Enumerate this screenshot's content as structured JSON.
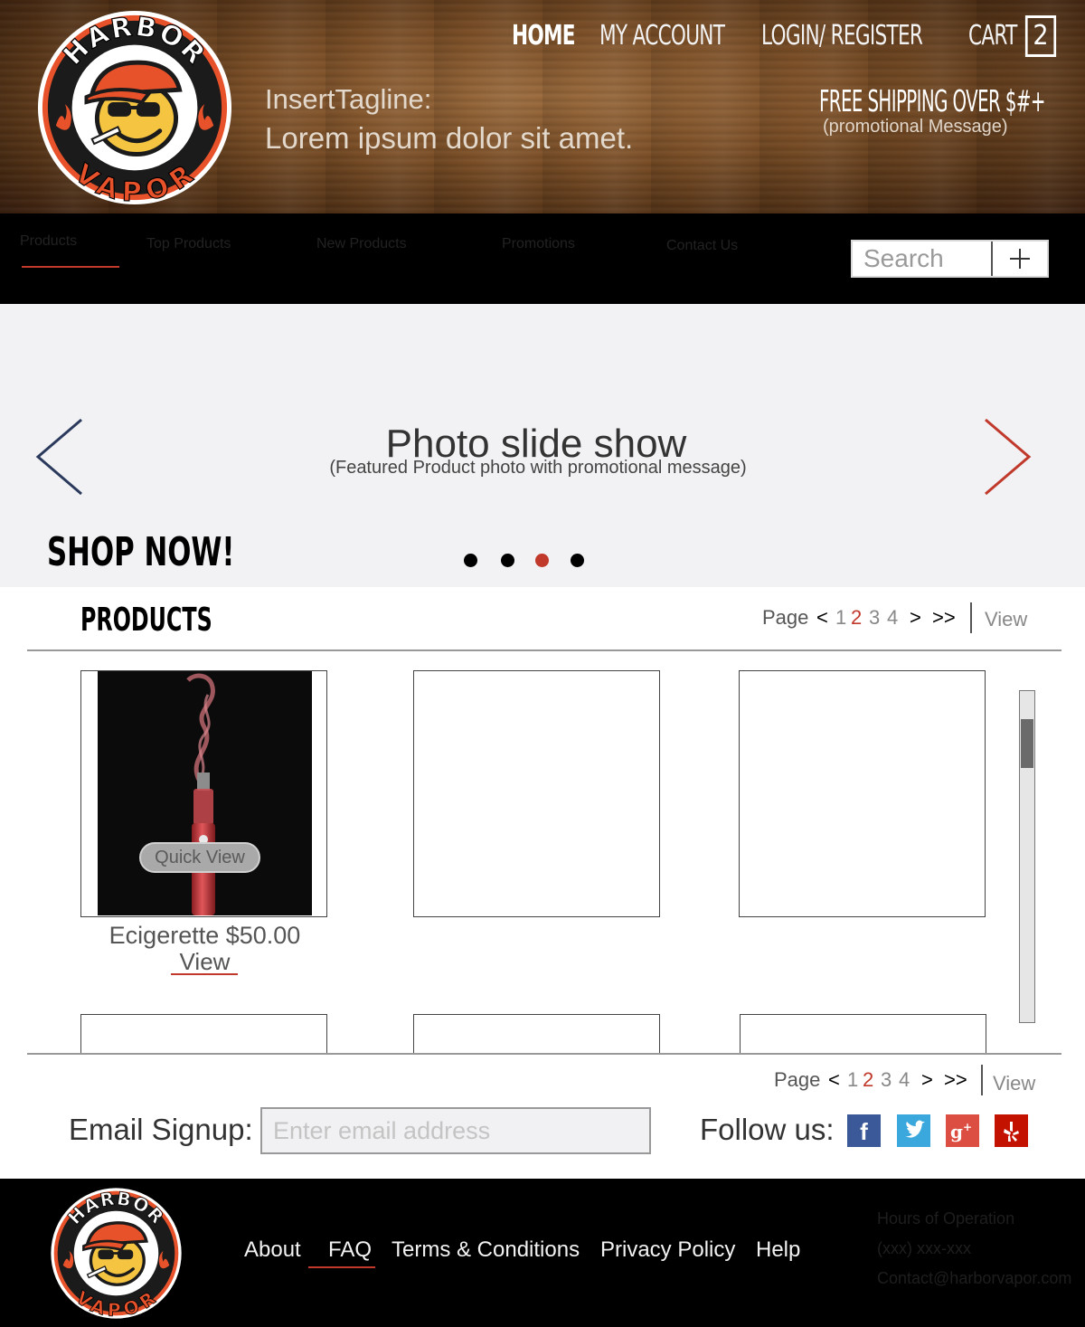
{
  "header": {
    "logo_text": {
      "top": "HARBOR",
      "bottom": "VAPOR"
    },
    "nav": [
      {
        "label": "HOME"
      },
      {
        "label": "MY ACCOUNT"
      },
      {
        "label": "LOGIN/ REGISTER"
      },
      {
        "label": "CART"
      }
    ],
    "cart_count": "2",
    "tagline_line1": "InsertTagline:",
    "tagline_line2": "Lorem ipsum dolor sit amet.",
    "shipping": "FREE SHIPPING OVER $#+",
    "promo": "(promotional Message)"
  },
  "navbar": {
    "items": [
      {
        "label": "Products"
      },
      {
        "label": "Top Products"
      },
      {
        "label": "New Products"
      },
      {
        "label": "Promotions"
      },
      {
        "label": "Contact Us"
      }
    ],
    "search_placeholder": "Search",
    "search_button_icon": "plus-icon"
  },
  "slideshow": {
    "title": "Photo slide show",
    "subtitle": "(Featured Product photo with promotional message)",
    "cta": "SHOP NOW!",
    "active_index": 2,
    "slide_count": 4
  },
  "products": {
    "title": "PRODUCTS",
    "pager": {
      "label": "Page",
      "prev": "<",
      "pages": [
        "1",
        "2",
        "3",
        "4"
      ],
      "current": "2",
      "next": ">",
      "last": ">>",
      "view": "View"
    },
    "items": [
      {
        "name": "Ecigerette $50.00",
        "view": "View",
        "quick_view": "Quick View"
      }
    ]
  },
  "signup": {
    "label": "Email Signup:",
    "placeholder": "Enter email address",
    "follow_label": "Follow us:",
    "social": [
      {
        "name": "facebook-icon",
        "color": "#3b5998",
        "glyph": "f"
      },
      {
        "name": "twitter-icon",
        "color": "#3aa7dd",
        "glyph": "t"
      },
      {
        "name": "google-plus-icon",
        "color": "#dc4e41",
        "glyph": "g+"
      },
      {
        "name": "yelp-icon",
        "color": "#c41200",
        "glyph": "y"
      }
    ]
  },
  "footer": {
    "links": [
      {
        "label": "About"
      },
      {
        "label": "FAQ"
      },
      {
        "label": "Terms & Conditions"
      },
      {
        "label": "Privacy Policy"
      },
      {
        "label": "Help"
      }
    ],
    "hours": "Hours of Operation",
    "phone": "(xxx) xxx-xxx",
    "email": "Contact@harborvapor.com"
  },
  "colors": {
    "accent": "#c0392b",
    "nav_bg": "#000000",
    "slide_bg": "#f2f2f4",
    "logo_orange": "#e8522b"
  }
}
